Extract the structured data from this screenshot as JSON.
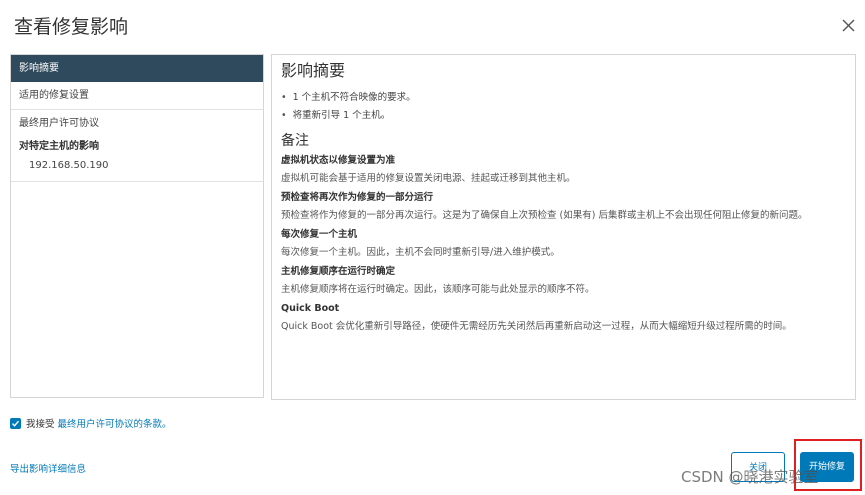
{
  "dialog": {
    "title": "查看修复影响"
  },
  "sidebar": {
    "items": [
      {
        "label": "影响摘要"
      },
      {
        "label": "适用的修复设置"
      },
      {
        "label": "最终用户许可协议"
      }
    ],
    "group_header": "对特定主机的影响",
    "sub_items": [
      {
        "label": "192.168.50.190"
      }
    ]
  },
  "content": {
    "heading": "影响摘要",
    "bullets": [
      "1 个主机不符合映像的要求。",
      "将重新引导 1 个主机。"
    ],
    "notes_heading": "备注",
    "sections": [
      {
        "title": "虚拟机状态以修复设置为准",
        "body": "虚拟机可能会基于适用的修复设置关闭电源、挂起或迁移到其他主机。"
      },
      {
        "title": "预检查将再次作为修复的一部分运行",
        "body": "预检查将作为修复的一部分再次运行。这是为了确保自上次预检查 (如果有) 后集群或主机上不会出现任何阻止修复的新问题。"
      },
      {
        "title": "每次修复一个主机",
        "body": "每次修复一个主机。因此，主机不会同时重新引导/进入维护模式。"
      },
      {
        "title": "主机修复顺序在运行时确定",
        "body": "主机修复顺序将在运行时确定。因此，该顺序可能与此处显示的顺序不符。"
      },
      {
        "title": "Quick Boot",
        "body": "Quick Boot 会优化重新引导路径，使硬件无需经历先关闭然后再重新启动这一过程，从而大幅缩短升级过程所需的时间。"
      }
    ]
  },
  "footer": {
    "accept_prefix": "我接受",
    "accept_link": "最终用户许可协议的条款。",
    "export_link": "导出影响详细信息",
    "cancel_label": "关闭",
    "primary_label": "开始修复"
  },
  "watermark": "CSDN @晓港实验室",
  "colors": {
    "accent": "#0079b8",
    "sidebar_active": "#2f4a5c",
    "highlight": "#e02020"
  }
}
